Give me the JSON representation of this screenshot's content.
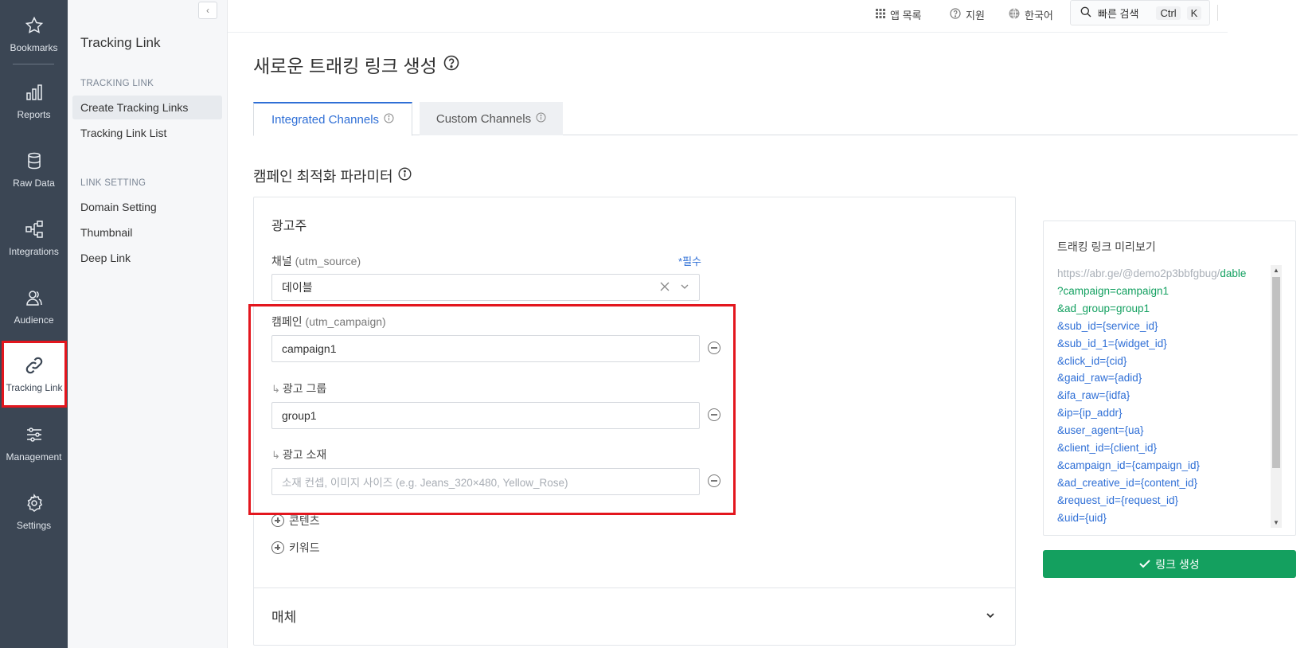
{
  "rail": {
    "items": [
      {
        "label": "Bookmarks",
        "icon": "star-icon"
      },
      {
        "label": "Reports",
        "icon": "bar-chart-icon"
      },
      {
        "label": "Raw Data",
        "icon": "database-icon"
      },
      {
        "label": "Integrations",
        "icon": "integrations-icon"
      },
      {
        "label": "Audience",
        "icon": "users-icon"
      },
      {
        "label": "Tracking Link",
        "icon": "link-icon",
        "active": true
      },
      {
        "label": "Management",
        "icon": "sliders-icon"
      },
      {
        "label": "Settings",
        "icon": "gear-icon"
      }
    ]
  },
  "subnav": {
    "collapse_label": "‹",
    "title": "Tracking Link",
    "sections": [
      {
        "heading": "TRACKING LINK",
        "items": [
          "Create Tracking Links",
          "Tracking Link List"
        ]
      },
      {
        "heading": "LINK SETTING",
        "items": [
          "Domain Setting",
          "Thumbnail",
          "Deep Link"
        ]
      }
    ]
  },
  "topbar": {
    "apps": "앱 목록",
    "support": "지원",
    "language": "한국어",
    "search": "빠른 검색",
    "shortcut_ctrl": "Ctrl",
    "shortcut_key": "K"
  },
  "main": {
    "title": "새로운 트래킹 링크 생성",
    "tabs": [
      {
        "label": "Integrated Channels",
        "active": true
      },
      {
        "label": "Custom Channels",
        "active": false
      }
    ],
    "section_title": "캠페인 최적화 파라미터",
    "card": {
      "subtitle": "광고주",
      "channel": {
        "label": "채널",
        "param": "(utm_source)",
        "required": "*필수",
        "value": "데이블"
      },
      "campaign": {
        "label": "캠페인",
        "param": "(utm_campaign)",
        "value": "campaign1"
      },
      "ad_group": {
        "arrow": "↳",
        "label": "광고 그룹",
        "value": "group1"
      },
      "ad_creative": {
        "arrow": "↳",
        "label": "광고 소재",
        "placeholder": "소재 컨셉, 이미지 사이즈 (e.g. Jeans_320×480, Yellow_Rose)"
      },
      "add_content": "콘텐츠",
      "add_keyword": "키워드",
      "media": "매체"
    }
  },
  "preview": {
    "title": "트래킹 링크 미리보기",
    "base_url": "https://abr.ge/@demo2p3bbfgbug/",
    "domain": "dable",
    "lines": [
      {
        "key": "?campaign=",
        "val": "campaign1",
        "green": true
      },
      {
        "key": "&ad_group=",
        "val": "group1",
        "green": true
      },
      {
        "key": "&sub_id=",
        "val": "{service_id}"
      },
      {
        "key": "&sub_id_1=",
        "val": "{widget_id}"
      },
      {
        "key": "&click_id=",
        "val": "{cid}"
      },
      {
        "key": "&gaid_raw=",
        "val": "{adid}"
      },
      {
        "key": "&ifa_raw=",
        "val": "{idfa}"
      },
      {
        "key": "&ip=",
        "val": "{ip_addr}"
      },
      {
        "key": "&user_agent=",
        "val": "{ua}"
      },
      {
        "key": "&client_id=",
        "val": "{client_id}"
      },
      {
        "key": "&campaign_id=",
        "val": "{campaign_id}"
      },
      {
        "key": "&ad_creative_id=",
        "val": "{content_id}"
      },
      {
        "key": "&request_id=",
        "val": "{request_id}"
      },
      {
        "key": "&uid=",
        "val": "{uid}"
      }
    ],
    "button": "링크 생성"
  }
}
